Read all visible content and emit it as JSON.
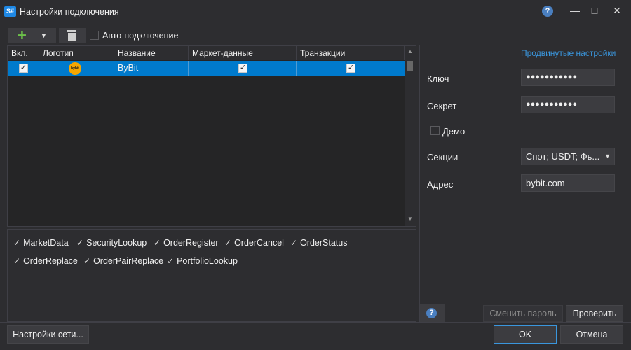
{
  "window": {
    "app_icon_text": "S#",
    "title": "Настройки подключения",
    "controls": [
      "?",
      "—",
      "□",
      "✕"
    ]
  },
  "toolbar": {
    "add_icon": "plus-icon",
    "delete_icon": "trash-icon",
    "auto_connect_label": "Авто-подключение",
    "auto_connect_checked": false
  },
  "grid": {
    "columns": [
      "Вкл.",
      "Логотип",
      "Название",
      "Маркет-данные",
      "Транзакции"
    ],
    "rows": [
      {
        "enabled": true,
        "logo_text": "bybit",
        "name": "ByBit",
        "market_data": true,
        "transactions": true
      }
    ],
    "selection_color": "#007acc"
  },
  "capabilities": [
    "MarketData",
    "SecurityLookup",
    "OrderRegister",
    "OrderCancel",
    "OrderStatus",
    "OrderReplace",
    "OrderPairReplace",
    "PortfolioLookup"
  ],
  "settings": {
    "advanced_link": "Продвинутые настройки",
    "key_label": "Ключ",
    "key_value": "●●●●●●●●●●●",
    "secret_label": "Секрет",
    "secret_value": "●●●●●●●●●●●",
    "demo_label": "Демо",
    "demo_checked": false,
    "sections_label": "Секции",
    "sections_value": "Спот; USDT; Фь...",
    "address_label": "Адрес",
    "address_value": "bybit.com"
  },
  "footer": {
    "network_settings": "Настройки сети...",
    "change_password": "Сменить пароль",
    "check": "Проверить",
    "ok": "OK",
    "cancel": "Отмена"
  },
  "colors": {
    "background": "#2d2d30",
    "accent": "#007acc",
    "link": "#3a96dd"
  }
}
